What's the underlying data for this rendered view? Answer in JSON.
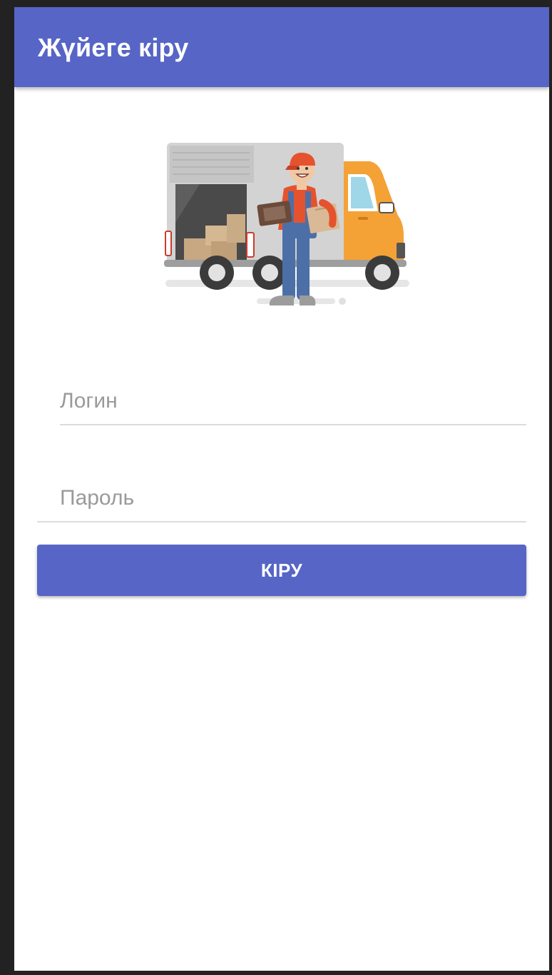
{
  "app_bar": {
    "title": "Жүйеге кіру"
  },
  "illustration": {
    "name": "delivery-truck-courier-illustration"
  },
  "form": {
    "login_placeholder": "Логин",
    "password_placeholder": "Пароль",
    "submit_label": "КІРУ"
  },
  "colors": {
    "primary": "#5665c6",
    "background": "#ffffff",
    "placeholder": "#9a9a9a",
    "underline": "#dcdcdc"
  }
}
